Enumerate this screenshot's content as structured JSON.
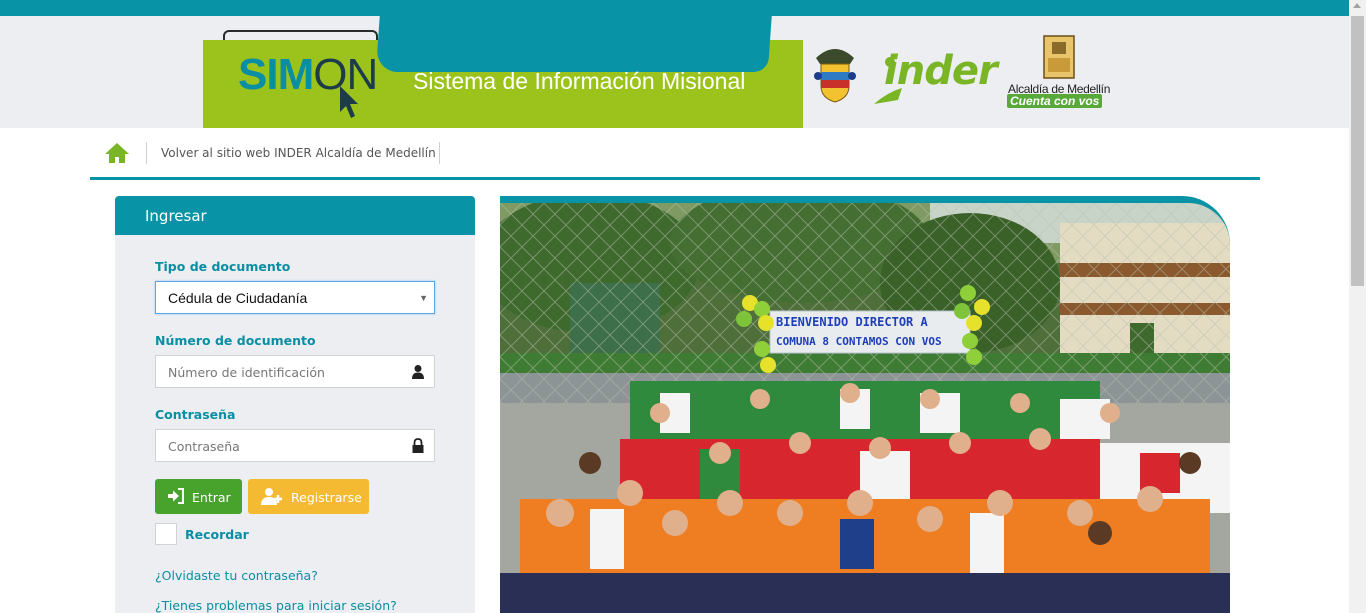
{
  "header": {
    "logo_prefix": "SIM",
    "logo_suffix": "ON",
    "title": "Sistema de Información Misional",
    "inder_logo": "inder",
    "alcaldia_line1": "Alcaldía de Medellín",
    "alcaldia_line2": "Cuenta con vos"
  },
  "nav": {
    "home_icon": "home-icon",
    "back_link": "Volver al sitio web INDER Alcaldía de Medellín"
  },
  "login": {
    "title": "Ingresar",
    "doc_type_label": "Tipo de documento",
    "doc_type_value": "Cédula de Ciudadanía",
    "doc_number_label": "Número de documento",
    "doc_number_placeholder": "Número de identificación",
    "password_label": "Contraseña",
    "password_placeholder": "Contraseña",
    "login_button": "Entrar",
    "register_button": "Registrarse",
    "remember_label": "Recordar",
    "forgot_link": "¿Olvidaste tu contraseña?",
    "problems_link": "¿Tienes problemas para iniciar sesión?"
  },
  "photo": {
    "banner_line1": "BIENVENIDO DIRECTOR A",
    "banner_line2": "COMUNA 8 CONTAMOS CON VOS"
  },
  "colors": {
    "brand_teal": "#0894a6",
    "brand_green": "#9cc31c",
    "button_green": "#48a32c",
    "button_yellow": "#f4bb32",
    "panel_bg": "#eceef2"
  }
}
